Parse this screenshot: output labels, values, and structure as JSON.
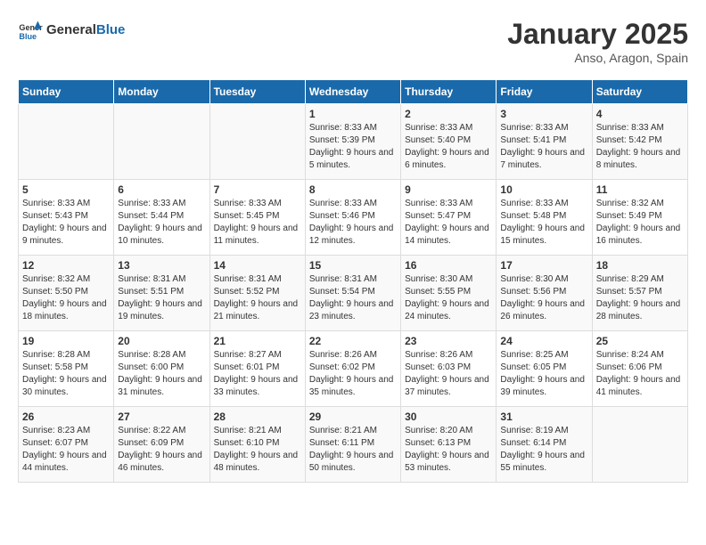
{
  "header": {
    "logo_general": "General",
    "logo_blue": "Blue",
    "title": "January 2025",
    "subtitle": "Anso, Aragon, Spain"
  },
  "weekdays": [
    "Sunday",
    "Monday",
    "Tuesday",
    "Wednesday",
    "Thursday",
    "Friday",
    "Saturday"
  ],
  "weeks": [
    [
      {
        "day": "",
        "sunrise": "",
        "sunset": "",
        "daylight": ""
      },
      {
        "day": "",
        "sunrise": "",
        "sunset": "",
        "daylight": ""
      },
      {
        "day": "",
        "sunrise": "",
        "sunset": "",
        "daylight": ""
      },
      {
        "day": "1",
        "sunrise": "Sunrise: 8:33 AM",
        "sunset": "Sunset: 5:39 PM",
        "daylight": "Daylight: 9 hours and 5 minutes."
      },
      {
        "day": "2",
        "sunrise": "Sunrise: 8:33 AM",
        "sunset": "Sunset: 5:40 PM",
        "daylight": "Daylight: 9 hours and 6 minutes."
      },
      {
        "day": "3",
        "sunrise": "Sunrise: 8:33 AM",
        "sunset": "Sunset: 5:41 PM",
        "daylight": "Daylight: 9 hours and 7 minutes."
      },
      {
        "day": "4",
        "sunrise": "Sunrise: 8:33 AM",
        "sunset": "Sunset: 5:42 PM",
        "daylight": "Daylight: 9 hours and 8 minutes."
      }
    ],
    [
      {
        "day": "5",
        "sunrise": "Sunrise: 8:33 AM",
        "sunset": "Sunset: 5:43 PM",
        "daylight": "Daylight: 9 hours and 9 minutes."
      },
      {
        "day": "6",
        "sunrise": "Sunrise: 8:33 AM",
        "sunset": "Sunset: 5:44 PM",
        "daylight": "Daylight: 9 hours and 10 minutes."
      },
      {
        "day": "7",
        "sunrise": "Sunrise: 8:33 AM",
        "sunset": "Sunset: 5:45 PM",
        "daylight": "Daylight: 9 hours and 11 minutes."
      },
      {
        "day": "8",
        "sunrise": "Sunrise: 8:33 AM",
        "sunset": "Sunset: 5:46 PM",
        "daylight": "Daylight: 9 hours and 12 minutes."
      },
      {
        "day": "9",
        "sunrise": "Sunrise: 8:33 AM",
        "sunset": "Sunset: 5:47 PM",
        "daylight": "Daylight: 9 hours and 14 minutes."
      },
      {
        "day": "10",
        "sunrise": "Sunrise: 8:33 AM",
        "sunset": "Sunset: 5:48 PM",
        "daylight": "Daylight: 9 hours and 15 minutes."
      },
      {
        "day": "11",
        "sunrise": "Sunrise: 8:32 AM",
        "sunset": "Sunset: 5:49 PM",
        "daylight": "Daylight: 9 hours and 16 minutes."
      }
    ],
    [
      {
        "day": "12",
        "sunrise": "Sunrise: 8:32 AM",
        "sunset": "Sunset: 5:50 PM",
        "daylight": "Daylight: 9 hours and 18 minutes."
      },
      {
        "day": "13",
        "sunrise": "Sunrise: 8:31 AM",
        "sunset": "Sunset: 5:51 PM",
        "daylight": "Daylight: 9 hours and 19 minutes."
      },
      {
        "day": "14",
        "sunrise": "Sunrise: 8:31 AM",
        "sunset": "Sunset: 5:52 PM",
        "daylight": "Daylight: 9 hours and 21 minutes."
      },
      {
        "day": "15",
        "sunrise": "Sunrise: 8:31 AM",
        "sunset": "Sunset: 5:54 PM",
        "daylight": "Daylight: 9 hours and 23 minutes."
      },
      {
        "day": "16",
        "sunrise": "Sunrise: 8:30 AM",
        "sunset": "Sunset: 5:55 PM",
        "daylight": "Daylight: 9 hours and 24 minutes."
      },
      {
        "day": "17",
        "sunrise": "Sunrise: 8:30 AM",
        "sunset": "Sunset: 5:56 PM",
        "daylight": "Daylight: 9 hours and 26 minutes."
      },
      {
        "day": "18",
        "sunrise": "Sunrise: 8:29 AM",
        "sunset": "Sunset: 5:57 PM",
        "daylight": "Daylight: 9 hours and 28 minutes."
      }
    ],
    [
      {
        "day": "19",
        "sunrise": "Sunrise: 8:28 AM",
        "sunset": "Sunset: 5:58 PM",
        "daylight": "Daylight: 9 hours and 30 minutes."
      },
      {
        "day": "20",
        "sunrise": "Sunrise: 8:28 AM",
        "sunset": "Sunset: 6:00 PM",
        "daylight": "Daylight: 9 hours and 31 minutes."
      },
      {
        "day": "21",
        "sunrise": "Sunrise: 8:27 AM",
        "sunset": "Sunset: 6:01 PM",
        "daylight": "Daylight: 9 hours and 33 minutes."
      },
      {
        "day": "22",
        "sunrise": "Sunrise: 8:26 AM",
        "sunset": "Sunset: 6:02 PM",
        "daylight": "Daylight: 9 hours and 35 minutes."
      },
      {
        "day": "23",
        "sunrise": "Sunrise: 8:26 AM",
        "sunset": "Sunset: 6:03 PM",
        "daylight": "Daylight: 9 hours and 37 minutes."
      },
      {
        "day": "24",
        "sunrise": "Sunrise: 8:25 AM",
        "sunset": "Sunset: 6:05 PM",
        "daylight": "Daylight: 9 hours and 39 minutes."
      },
      {
        "day": "25",
        "sunrise": "Sunrise: 8:24 AM",
        "sunset": "Sunset: 6:06 PM",
        "daylight": "Daylight: 9 hours and 41 minutes."
      }
    ],
    [
      {
        "day": "26",
        "sunrise": "Sunrise: 8:23 AM",
        "sunset": "Sunset: 6:07 PM",
        "daylight": "Daylight: 9 hours and 44 minutes."
      },
      {
        "day": "27",
        "sunrise": "Sunrise: 8:22 AM",
        "sunset": "Sunset: 6:09 PM",
        "daylight": "Daylight: 9 hours and 46 minutes."
      },
      {
        "day": "28",
        "sunrise": "Sunrise: 8:21 AM",
        "sunset": "Sunset: 6:10 PM",
        "daylight": "Daylight: 9 hours and 48 minutes."
      },
      {
        "day": "29",
        "sunrise": "Sunrise: 8:21 AM",
        "sunset": "Sunset: 6:11 PM",
        "daylight": "Daylight: 9 hours and 50 minutes."
      },
      {
        "day": "30",
        "sunrise": "Sunrise: 8:20 AM",
        "sunset": "Sunset: 6:13 PM",
        "daylight": "Daylight: 9 hours and 53 minutes."
      },
      {
        "day": "31",
        "sunrise": "Sunrise: 8:19 AM",
        "sunset": "Sunset: 6:14 PM",
        "daylight": "Daylight: 9 hours and 55 minutes."
      },
      {
        "day": "",
        "sunrise": "",
        "sunset": "",
        "daylight": ""
      }
    ]
  ]
}
